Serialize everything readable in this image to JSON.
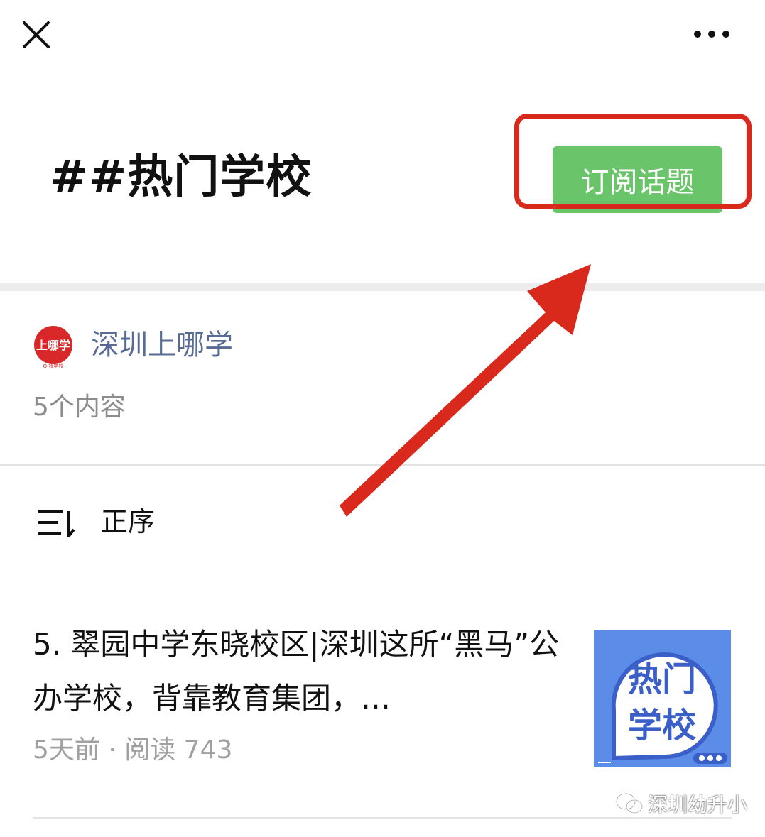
{
  "topbar": {
    "close_icon": "close-icon",
    "more_icon": "more-horizontal-icon"
  },
  "topic": {
    "title": "##热门学校",
    "subscribe_label": "订阅话题",
    "subscribe_color": "#6ac46a"
  },
  "account": {
    "avatar_text": "上哪学",
    "avatar_subtext": "Q 找学校",
    "avatar_color": "#d9282a",
    "name": "深圳上哪学",
    "content_count": "5个内容"
  },
  "sort": {
    "icon": "sort-icon",
    "label": "正序"
  },
  "articles": [
    {
      "title": "5. 翠园中学东晓校区|深圳这所“黑马”公办学校，背靠教育集团，…",
      "meta": "5天前 · 阅读 743",
      "thumb_line1": "热门",
      "thumb_line2": "学校",
      "thumb_bg": "#5b8de8",
      "thumb_text_color": "#3b5fc9"
    }
  ],
  "watermark": {
    "text": "深圳幼升小",
    "icon": "wechat-icon"
  },
  "annotation": {
    "color": "#d9281c"
  }
}
